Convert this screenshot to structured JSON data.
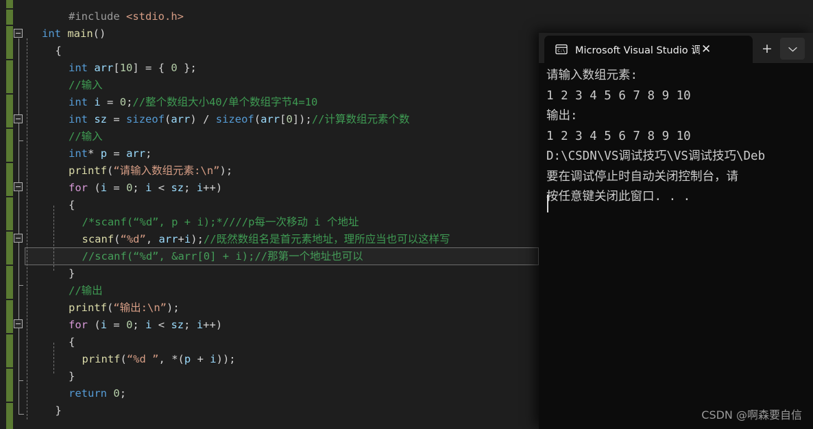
{
  "editor": {
    "name": "visual-studio-code-editor",
    "background": "#1e1e1e",
    "change_bar_color": "#5a7a32",
    "lines": [
      {
        "indent": 2,
        "text": "#include <stdio.h>"
      },
      {
        "indent": 0,
        "text": "int main()"
      },
      {
        "indent": 1,
        "text": "{"
      },
      {
        "indent": 2,
        "text": "int arr[10] = { 0 };"
      },
      {
        "indent": 2,
        "text": "//输入"
      },
      {
        "indent": 2,
        "text": "int i = 0;//整个数组大小40/单个数组字节4=10"
      },
      {
        "indent": 2,
        "text": "int sz = sizeof(arr) / sizeof(arr[0]);//计算数组元素个数"
      },
      {
        "indent": 2,
        "text": "//输入"
      },
      {
        "indent": 2,
        "text": "int* p = arr;"
      },
      {
        "indent": 2,
        "text": "printf(“请输入数组元素:\\n”);"
      },
      {
        "indent": 2,
        "text": "for (i = 0; i < sz; i++)"
      },
      {
        "indent": 2,
        "text": "{"
      },
      {
        "indent": 3,
        "text": "/*scanf(“%d”, p + i);*////p每一次移动 i 个地址"
      },
      {
        "indent": 3,
        "text": "scanf(“%d”, arr+i);//既然数组名是首元素地址，理所应当也可以这样写"
      },
      {
        "indent": 3,
        "text": "//scanf(“%d”, &arr[0] + i);//那第一个地址也可以"
      },
      {
        "indent": 2,
        "text": "}"
      },
      {
        "indent": 2,
        "text": "//输出"
      },
      {
        "indent": 2,
        "text": "printf(“输出:\\n”);"
      },
      {
        "indent": 2,
        "text": "for (i = 0; i < sz; i++)"
      },
      {
        "indent": 2,
        "text": "{"
      },
      {
        "indent": 3,
        "text": "printf(“%d ”, *(p + i));"
      },
      {
        "indent": 2,
        "text": "}"
      },
      {
        "indent": 2,
        "text": "return 0;"
      },
      {
        "indent": 1,
        "text": "}"
      }
    ],
    "current_line_index": 14,
    "error_squiggle_on_line": 13
  },
  "console": {
    "name": "visual-studio-debug-console",
    "tab_title": "Microsoft Visual Studio 调试控",
    "tab_icon": "console-icon",
    "close_label": "✕",
    "new_tab_label": "+",
    "menu_label": "ˇ",
    "background": "#0c0c0c",
    "output_lines": [
      "请输入数组元素:",
      "1 2 3 4 5 6 7 8 9 10",
      "输出:",
      "1 2 3 4 5 6 7 8 9 10",
      "D:\\CSDN\\VS调试技巧\\VS调试技巧\\Deb",
      "要在调试停止时自动关闭控制台，请",
      "按任意键关闭此窗口. . ."
    ]
  },
  "watermark": {
    "text": "CSDN @啊森要自信"
  }
}
